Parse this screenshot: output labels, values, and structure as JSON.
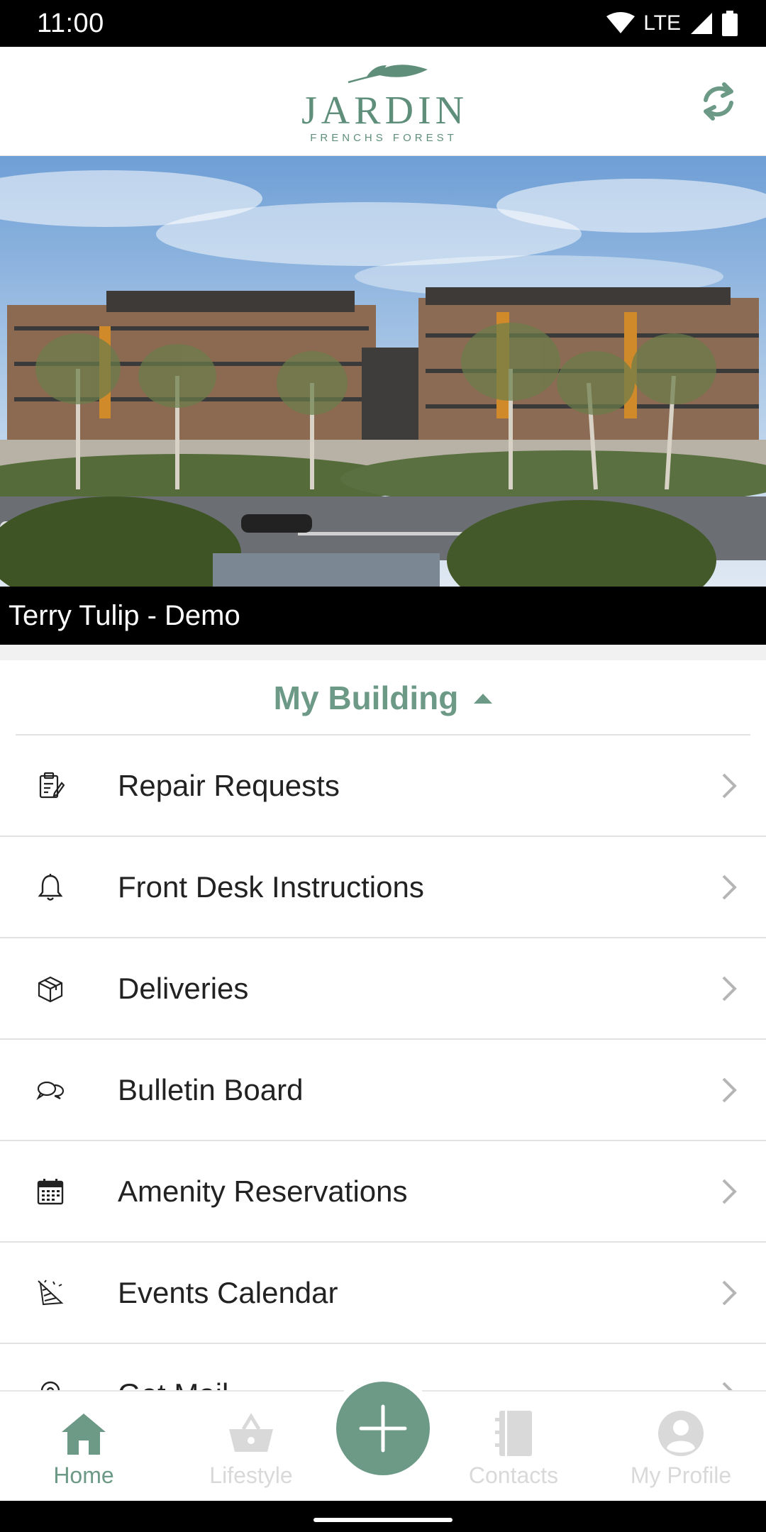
{
  "status_bar": {
    "time": "11:00",
    "network": "LTE"
  },
  "header": {
    "logo_text": "JARDIN",
    "logo_subtext": "FRENCHS FOREST",
    "accent_color": "#6d9a86"
  },
  "hero": {
    "caption": "Terry Tulip - Demo"
  },
  "section": {
    "title": "My Building"
  },
  "menu": [
    {
      "label": "Repair Requests",
      "icon": "repair-clipboard-icon"
    },
    {
      "label": "Front Desk Instructions",
      "icon": "bell-icon"
    },
    {
      "label": "Deliveries",
      "icon": "package-box-icon"
    },
    {
      "label": "Bulletin Board",
      "icon": "chat-bubbles-icon"
    },
    {
      "label": "Amenity Reservations",
      "icon": "calendar-icon"
    },
    {
      "label": "Events Calendar",
      "icon": "party-hat-icon"
    },
    {
      "label": "Get Mail",
      "icon": "location-pin-icon"
    }
  ],
  "bottom_nav": {
    "home": "Home",
    "lifestyle": "Lifestyle",
    "contacts": "Contacts",
    "profile": "My Profile",
    "active": "home"
  }
}
